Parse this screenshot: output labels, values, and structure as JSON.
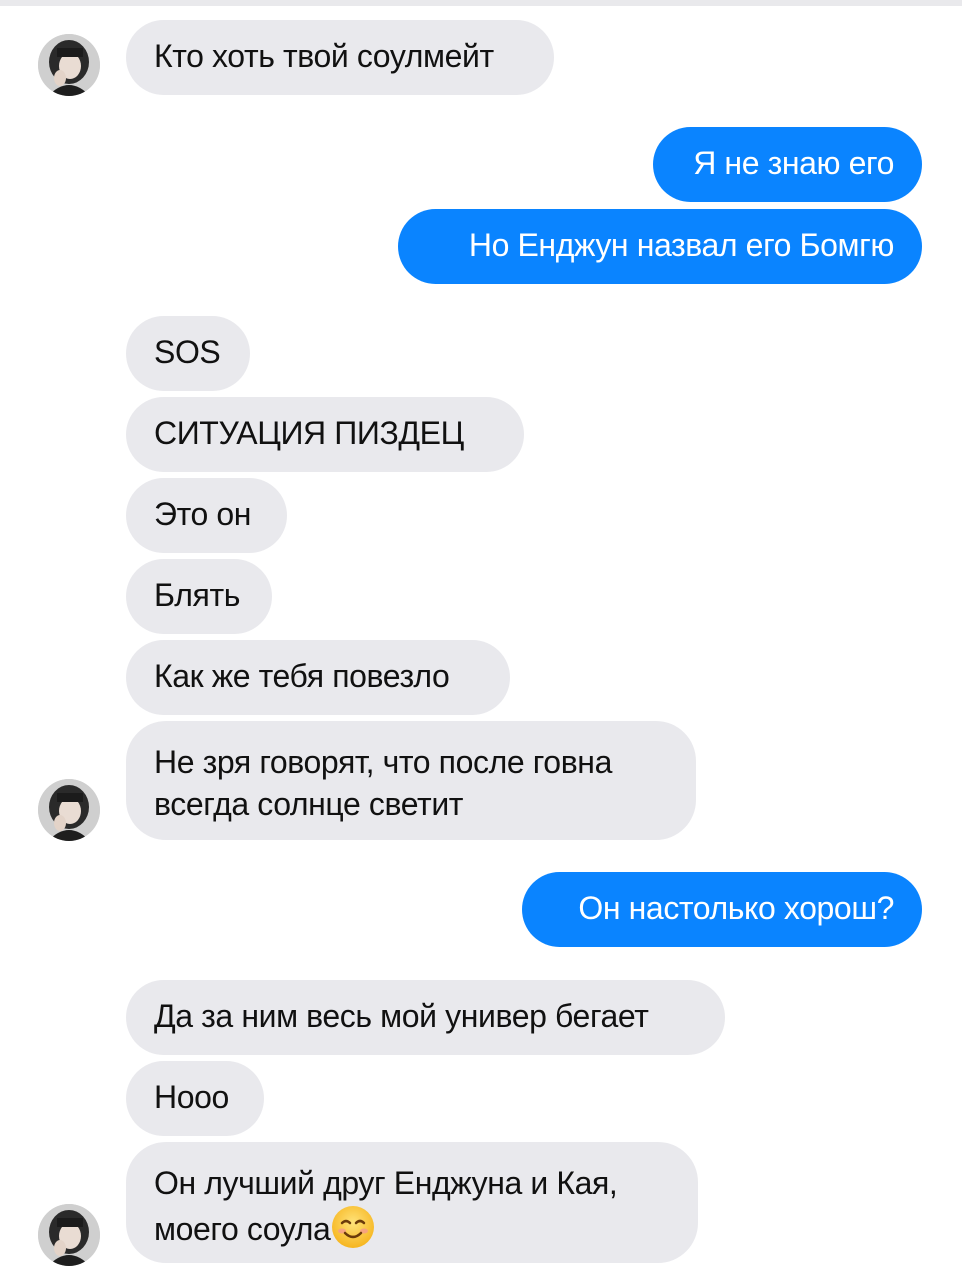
{
  "chat": {
    "messages": [
      {
        "id": "m1",
        "side": "in",
        "text": "Кто хоть твой соулмейт"
      },
      {
        "id": "m2",
        "side": "out",
        "text": "Я не знаю его"
      },
      {
        "id": "m3",
        "side": "out",
        "text": "Но Енджун назвал его Бомгю"
      },
      {
        "id": "m4",
        "side": "in",
        "text": "SOS"
      },
      {
        "id": "m5",
        "side": "in",
        "text": "СИТУАЦИЯ ПИЗДЕЦ"
      },
      {
        "id": "m6",
        "side": "in",
        "text": "Это он"
      },
      {
        "id": "m7",
        "side": "in",
        "text": "Блять"
      },
      {
        "id": "m8",
        "side": "in",
        "text": "Как же тебя повезло"
      },
      {
        "id": "m9",
        "side": "in",
        "lines": [
          "Не зря говорят, что после говна",
          "всегда солнце светит"
        ]
      },
      {
        "id": "m10",
        "side": "out",
        "text": "Он настолько хорош?"
      },
      {
        "id": "m11",
        "side": "in",
        "text": "Да за ним весь мой универ бегает"
      },
      {
        "id": "m12",
        "side": "in",
        "text": "Нооо"
      },
      {
        "id": "m13",
        "side": "in",
        "lines": [
          "Он лучший друг Енджуна и Кая,",
          "моего соула"
        ],
        "emoji": "smiling-face-emoji"
      }
    ]
  },
  "colors": {
    "incoming_bubble": "#e9e9ed",
    "outgoing_bubble": "#0a84ff",
    "outgoing_text": "#ffffff",
    "incoming_text": "#111111"
  },
  "icons": {
    "avatar": "contact-avatar-photo",
    "emoji": "smiling-face-emoji"
  }
}
